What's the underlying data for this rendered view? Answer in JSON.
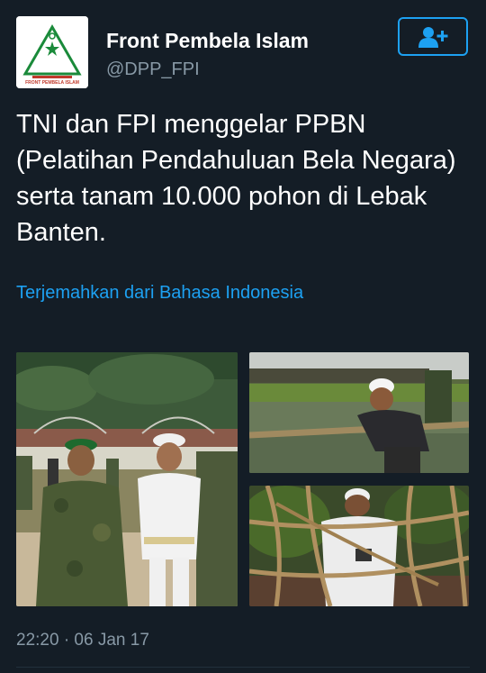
{
  "profile": {
    "display_name": "Front Pembela Islam",
    "handle": "@DPP_FPI",
    "avatar_icon": "fpi-logo",
    "logo_text": "FRONT PEMBELA ISLAM"
  },
  "follow_button": {
    "icon": "add-user-icon"
  },
  "tweet": {
    "lines": [
      "TNI dan FPI menggelar PPBN",
      "(Pelatihan Pendahuluan Bela Negara)",
      "serta tanam 10.000 pohon di Lebak",
      "Banten."
    ]
  },
  "translate_link": "Terjemahkan dari Bahasa Indonesia",
  "photos": [
    {
      "subject": "soldier-and-student-photo"
    },
    {
      "subject": "rope-crossing-river-photo"
    },
    {
      "subject": "rope-obstacle-photo"
    }
  ],
  "timestamp": "22:20 · 06 Jan 17",
  "colors": {
    "background": "#141d26",
    "accent": "#1da1f2",
    "secondary_text": "#8899a6"
  }
}
